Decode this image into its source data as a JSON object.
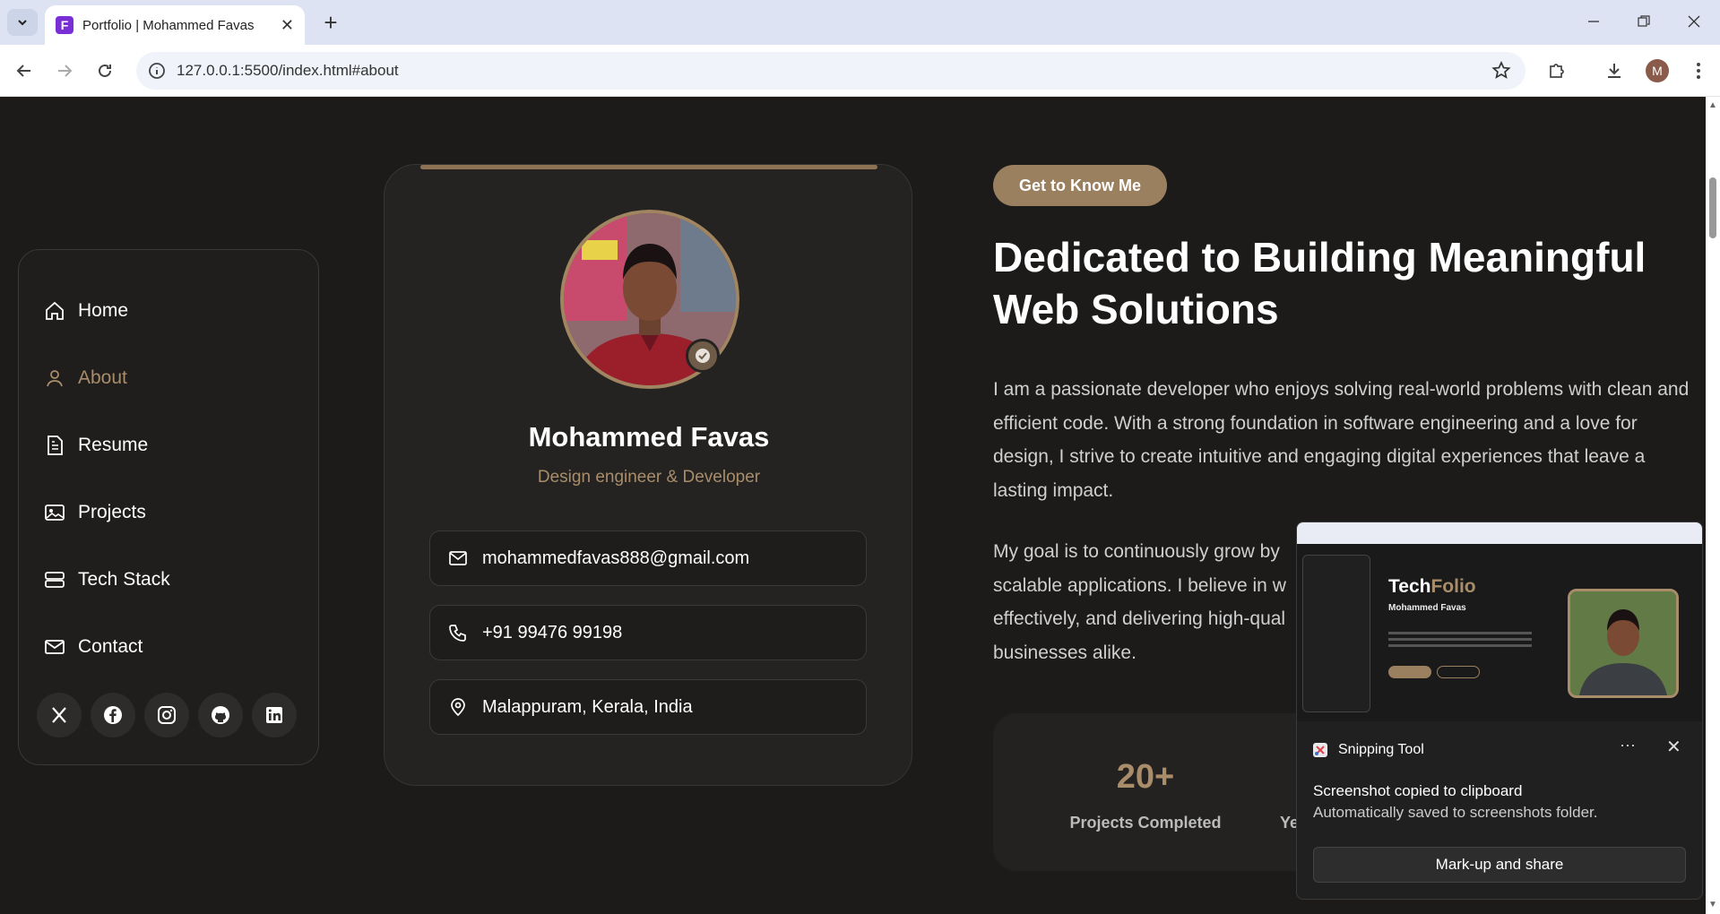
{
  "browser": {
    "tab_title": "Portfolio | Mohammed Favas",
    "tab_favicon_letter": "F",
    "url": "127.0.0.1:5500/index.html#about",
    "profile_initial": "M"
  },
  "sidebar": {
    "items": [
      {
        "label": "Home",
        "icon": "home-icon"
      },
      {
        "label": "About",
        "icon": "user-icon",
        "active": true
      },
      {
        "label": "Resume",
        "icon": "document-icon"
      },
      {
        "label": "Projects",
        "icon": "image-icon"
      },
      {
        "label": "Tech Stack",
        "icon": "server-icon"
      },
      {
        "label": "Contact",
        "icon": "mail-icon"
      }
    ],
    "socials": [
      "x-icon",
      "facebook-icon",
      "instagram-icon",
      "github-icon",
      "linkedin-icon"
    ]
  },
  "profile": {
    "name": "Mohammed Favas",
    "role": "Design engineer & Developer",
    "email": "mohammedfavas888@gmail.com",
    "phone": "+91 99476 99198",
    "location": "Malappuram, Kerala, India"
  },
  "about": {
    "pill": "Get to Know Me",
    "heading": "Dedicated to Building Meaningful Web Solutions",
    "para1": "I am a passionate developer who enjoys solving real-world problems with clean and efficient code. With a strong foundation in software engineering and a love for design, I strive to create intuitive and engaging digital experiences that leave a lasting impact.",
    "para2_lines": [
      "My goal is to continuously grow by",
      "scalable applications. I believe in w",
      "effectively, and delivering high-qual",
      "businesses alike."
    ]
  },
  "stats": [
    {
      "value": "20+",
      "label": "Projects Completed"
    },
    {
      "value": "",
      "label": "Ye"
    }
  ],
  "toast": {
    "app": "Snipping Tool",
    "message": "Screenshot copied to clipboard",
    "submessage": "Automatically saved to screenshots folder.",
    "button": "Mark-up and share",
    "thumb_brand_a": "Tech",
    "thumb_brand_b": "Folio",
    "thumb_name": "Mohammed Favas"
  },
  "colors": {
    "accent": "#a98d6a",
    "page_bg": "#1c1b1a"
  }
}
